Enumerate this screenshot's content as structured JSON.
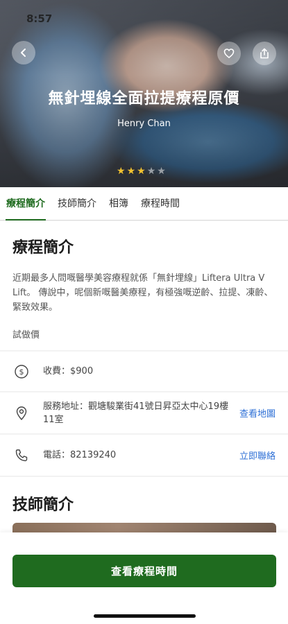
{
  "status_bar": {
    "time": "8:57"
  },
  "hero": {
    "title": "無針埋線全面拉提療程原價",
    "subtitle": "Henry Chan",
    "rating": 3,
    "rating_max": 5
  },
  "tabs": [
    {
      "label": "療程簡介",
      "active": true
    },
    {
      "label": "技師簡介",
      "active": false
    },
    {
      "label": "相簿",
      "active": false
    },
    {
      "label": "療程時間",
      "active": false
    }
  ],
  "intro": {
    "title": "療程簡介",
    "body": "近期最多人問嘅醫學美容療程就係「無針埋線」Liftera Ultra V Lift。 傳說中，呢個新嘅醫美療程，有極強嘅逆齡、拉提、凍齡、緊致效果。",
    "note": "試做價"
  },
  "info_rows": {
    "fee": {
      "text": "收費：$900"
    },
    "address": {
      "text": "服務地址：觀塘駿業街41號日昇亞太中心19樓11室",
      "action": "查看地圖"
    },
    "phone": {
      "text": "電話：82139240",
      "action": "立即聯絡"
    }
  },
  "technician": {
    "title": "技師簡介"
  },
  "cta": {
    "label": "查看療程時間"
  },
  "colors": {
    "brand_green": "#1f6b1f",
    "link_blue": "#2d6fd6",
    "star_on": "#f2c230",
    "star_off": "#9aa0a6"
  }
}
